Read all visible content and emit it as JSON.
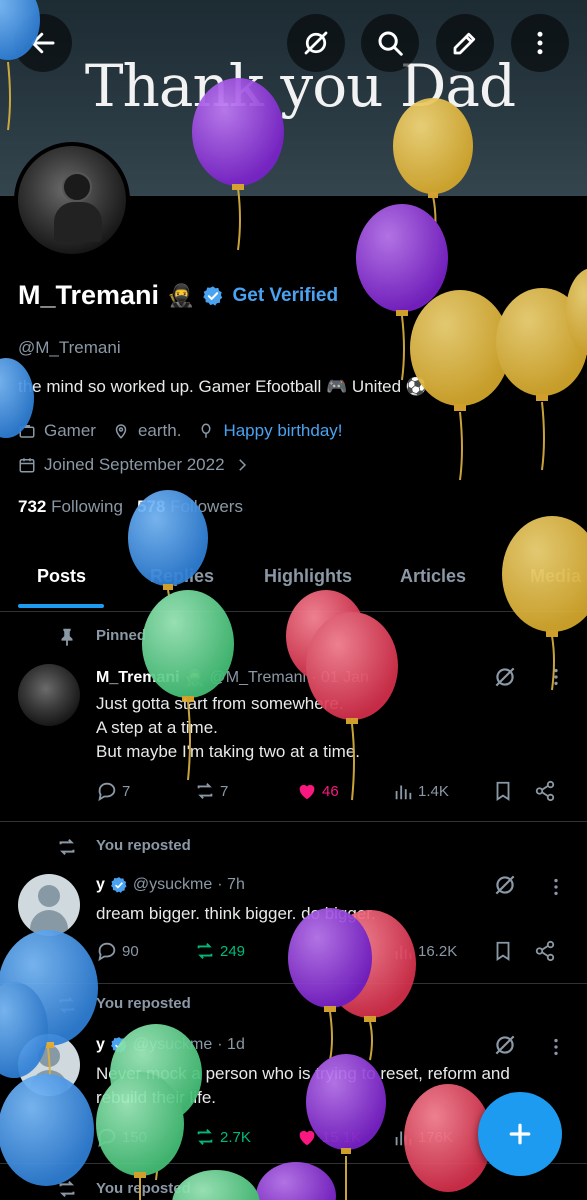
{
  "banner": {
    "text": "Thank you Dad"
  },
  "profile": {
    "name": "M_Tremani",
    "name_emoji": "🥷",
    "get_verified": "Get Verified",
    "handle": "@M_Tremani",
    "bio": "the mind so worked up.  Gamer   Efootball 🎮  United ⚽",
    "category": "Gamer",
    "location": "earth.",
    "link": "Happy birthday!",
    "joined": "Joined September 2022",
    "following_count": "732",
    "following_label": "Following",
    "followers_count": "578",
    "followers_label": "Followers"
  },
  "tabs": [
    "Posts",
    "Replies",
    "Highlights",
    "Articles",
    "Media"
  ],
  "posts": [
    {
      "context": "Pinned",
      "name": "M_Tremani",
      "name_emoji": "🥷",
      "handle": "@M_Tremani",
      "time": "· 01 Jan",
      "lines": [
        "Just gotta start from somewhere.",
        "A step at a time.",
        "But maybe I'm taking two at a time."
      ],
      "replies": "7",
      "reposts": "7",
      "likes": "46",
      "views": "1.4K"
    },
    {
      "context": "You reposted",
      "name": "y",
      "handle": "@ysuckme",
      "time": "· 7h",
      "lines": [
        "dream bigger. think bigger. do bigger."
      ],
      "replies": "90",
      "reposts": "249",
      "likes": "",
      "views": "16.2K"
    },
    {
      "context": "You reposted",
      "name": "y",
      "handle": "@ysuckme",
      "time": "· 1d",
      "lines": [
        "Never mock a person who is trying to reset, reform and",
        "rebuild their life."
      ],
      "replies": "150",
      "reposts": "2.7K",
      "likes": "15.1K",
      "views": "176K"
    },
    {
      "context": "You reposted"
    }
  ],
  "icons": {
    "back": "back-arrow-icon",
    "grok": "grok-icon",
    "search": "search-icon",
    "edit": "edit-icon",
    "more": "more-vertical-icon",
    "compose": "plus-icon"
  },
  "colors": {
    "accent": "#1d9bf0",
    "link": "#4aa3f0",
    "like": "#f91880",
    "repost": "#00ba7c",
    "balloon_purple": "#8a2be2",
    "balloon_yellow": "#e3b93a",
    "balloon_blue": "#3d8fe0",
    "balloon_green": "#5fd68a",
    "balloon_red": "#e0405a"
  }
}
